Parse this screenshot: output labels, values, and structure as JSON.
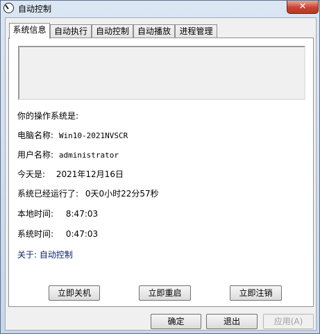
{
  "window": {
    "title": "自动控制",
    "close_label": "✕"
  },
  "tabs": [
    {
      "label": "系统信息"
    },
    {
      "label": "自动执行"
    },
    {
      "label": "自动控制"
    },
    {
      "label": "自动播放"
    },
    {
      "label": "进程管理"
    }
  ],
  "info": {
    "os_label": "你的操作系统是:",
    "computer_label": "电脑名称:",
    "computer_value": "Win10-2021NVSCR",
    "user_label": "用户名称:",
    "user_value": "administrator",
    "today_label": "今天是:",
    "today_value": "2021年12月16日",
    "uptime_label": "系统已经运行了:",
    "uptime_value": "0天0小时22分57秒",
    "local_time_label": "本地时间:",
    "local_time_value": "8:47:03",
    "system_time_label": "系统时间:",
    "system_time_value": "0:47:03",
    "about": "关于: 自动控制"
  },
  "actions": {
    "shutdown": "立即关机",
    "restart": "立即重启",
    "logoff": "立即注销"
  },
  "dialog": {
    "ok": "确定",
    "exit": "退出",
    "apply": "应用(A)"
  }
}
